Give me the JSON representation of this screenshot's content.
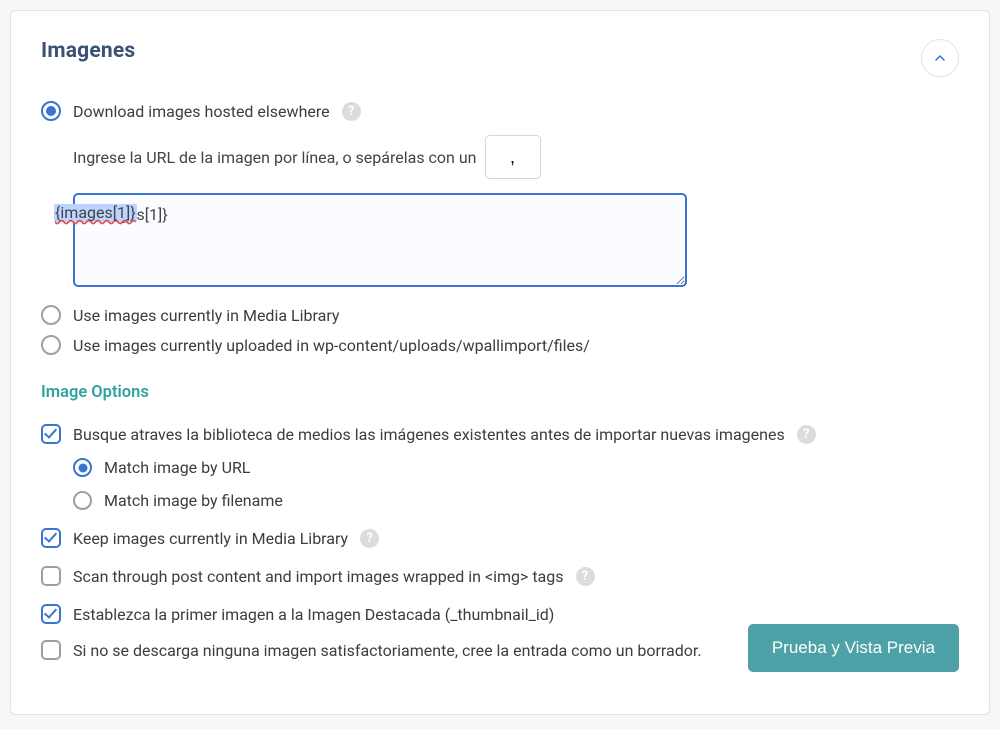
{
  "panel": {
    "title": "Imagenes"
  },
  "source": {
    "download_label": "Download images hosted elsewhere",
    "url_instruction": "Ingrese la URL de la imagen por línea, o sepárelas con un",
    "separator_value": ",",
    "urls_value": "{images[1]}",
    "media_library_label": "Use images currently in Media Library",
    "uploads_label": "Use images currently uploaded in wp-content/uploads/wpallimport/files/"
  },
  "options": {
    "heading": "Image Options",
    "search_existing_label": "Busque atraves la biblioteca de medios las imágenes existentes antes de importar nuevas imagenes",
    "match_url_label": "Match image by URL",
    "match_filename_label": "Match image by filename",
    "keep_images_label": "Keep images currently in Media Library",
    "scan_content_label": "Scan through post content and import images wrapped in <img> tags",
    "featured_label": "Establezca la primer imagen a la Imagen Destacada (_thumbnail_id)",
    "draft_label": "Si no se descarga ninguna imagen satisfactoriamente, cree la entrada como un borrador."
  },
  "buttons": {
    "preview": "Prueba y Vista Previa"
  },
  "icons": {
    "help": "?"
  }
}
